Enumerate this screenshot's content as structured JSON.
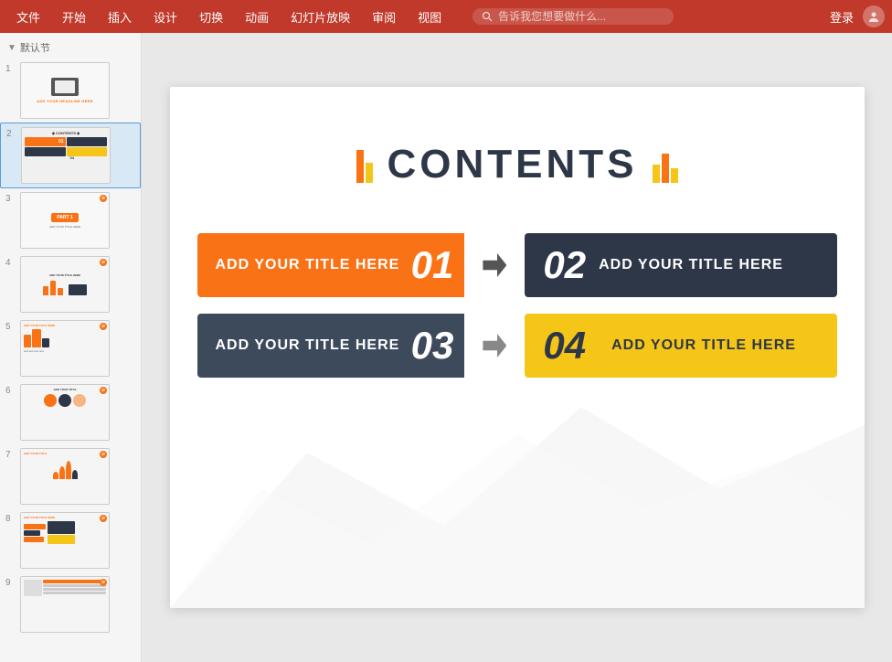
{
  "menubar": {
    "bg_color": "#c0392b",
    "items": [
      "文件",
      "开始",
      "插入",
      "设计",
      "切换",
      "动画",
      "幻灯片放映",
      "审阅",
      "视图"
    ],
    "search_placeholder": "告诉我您想要做什么...",
    "login_label": "登录"
  },
  "sidebar": {
    "section_label": "默认节",
    "slides": [
      {
        "num": "1"
      },
      {
        "num": "2",
        "active": true
      },
      {
        "num": "3"
      },
      {
        "num": "4"
      },
      {
        "num": "5"
      },
      {
        "num": "6"
      },
      {
        "num": "7"
      },
      {
        "num": "8"
      },
      {
        "num": "9"
      }
    ]
  },
  "slide": {
    "title": "CONTENTS",
    "boxes": [
      {
        "id": "box1",
        "title": "ADD YOUR TITLE HERE",
        "number": "01",
        "color": "orange"
      },
      {
        "id": "box2",
        "title": "ADD YOUR TITLE HERE",
        "number": "02",
        "color": "dark"
      },
      {
        "id": "box3",
        "title": "ADD YOUR TITLE HERE",
        "number": "03",
        "color": "dark-gray"
      },
      {
        "id": "box4",
        "title": "ADD YOUR TITLE HERE",
        "number": "04",
        "color": "yellow"
      }
    ]
  }
}
